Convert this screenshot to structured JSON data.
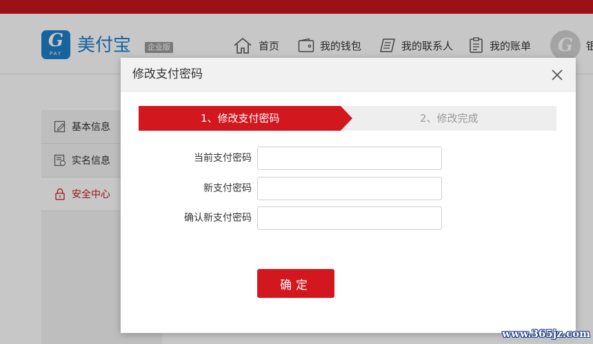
{
  "header": {
    "brand": "美付宝",
    "edition": "企业版",
    "logo_mark": "G",
    "logo_sub": "PAY",
    "nav": [
      {
        "label": "首页",
        "icon": "home-icon"
      },
      {
        "label": "我的钱包",
        "icon": "wallet-icon"
      },
      {
        "label": "我的联系人",
        "icon": "contacts-icon"
      },
      {
        "label": "我的账单",
        "icon": "bill-icon"
      }
    ],
    "nav_cut": "银"
  },
  "sidebar": {
    "items": [
      {
        "label": "基本信息",
        "icon": "edit-icon"
      },
      {
        "label": "实名信息",
        "icon": "id-card-icon"
      },
      {
        "label": "安全中心",
        "icon": "lock-icon",
        "active": true
      }
    ]
  },
  "modal": {
    "title": "修改支付密码",
    "steps": [
      {
        "label": "1、修改支付密码",
        "active": true
      },
      {
        "label": "2、修改完成",
        "active": false
      }
    ],
    "fields": [
      {
        "label": "当前支付密码",
        "value": ""
      },
      {
        "label": "新支付密码",
        "value": ""
      },
      {
        "label": "确认新支付密码",
        "value": ""
      }
    ],
    "confirm_label": "确定"
  },
  "watermark": "www.365jz.com",
  "colors": {
    "accent": "#d2171e",
    "brand": "#1e7fc9",
    "step_inactive_text": "#999999"
  }
}
